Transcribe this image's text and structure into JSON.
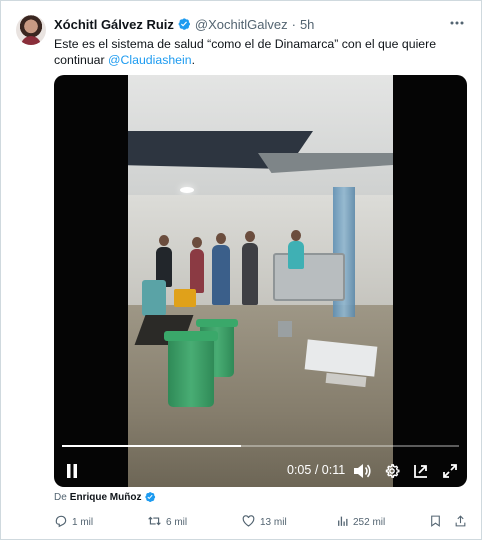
{
  "tweet": {
    "author_name": "Xóchitl Gálvez Ruiz",
    "handle": "@XochitlGalvez",
    "separator": "·",
    "time": "5h",
    "text_prefix": "Este es el sistema de salud “como el de Dinamarca” con el que quiere continuar ",
    "mention": "@Claudiashein",
    "text_suffix": "."
  },
  "video": {
    "current_time": "0:05",
    "time_separator": "/",
    "duration": "0:11",
    "progress_fraction": 0.45
  },
  "credit": {
    "prefix": "De",
    "name": "Enrique Muñoz"
  },
  "actions": {
    "replies": "1 mil",
    "reposts": "6 mil",
    "likes": "13 mil",
    "views": "252 mil"
  },
  "colors": {
    "accent": "#1d9bf0",
    "text": "#0f1419",
    "secondary_text": "#536471"
  },
  "icons": [
    "more-icon",
    "verified-icon",
    "play-pause-icon",
    "volume-icon",
    "settings-icon",
    "pip-icon",
    "fullscreen-icon",
    "reply-icon",
    "repost-icon",
    "like-icon",
    "views-icon",
    "bookmark-icon",
    "share-icon"
  ]
}
